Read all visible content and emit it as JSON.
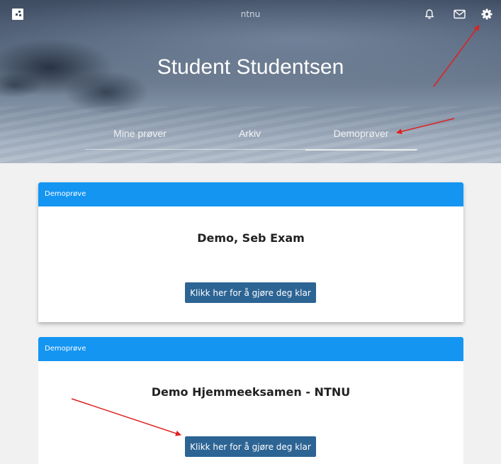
{
  "header": {
    "app_title": "ntnu",
    "user_name": "Student Studentsen",
    "icons": [
      "logo-icon",
      "bell-icon",
      "mail-icon",
      "gear-icon"
    ]
  },
  "tabs": [
    {
      "label": "Mine prøver",
      "active": false
    },
    {
      "label": "Arkiv",
      "active": false
    },
    {
      "label": "Demoprøver",
      "active": true
    }
  ],
  "cards": [
    {
      "header": "Demoprøve",
      "title": "Demo, Seb Exam",
      "button": "Klikk her for å gjøre deg klar"
    },
    {
      "header": "Demoprøve",
      "title": "Demo Hjemmeeksamen - NTNU",
      "button": "Klikk her for å gjøre deg klar"
    }
  ],
  "colors": {
    "card_header": "#1495f2",
    "button": "#2c6494",
    "annotation_arrow": "#e02020",
    "page_background": "#f1f1f1"
  }
}
